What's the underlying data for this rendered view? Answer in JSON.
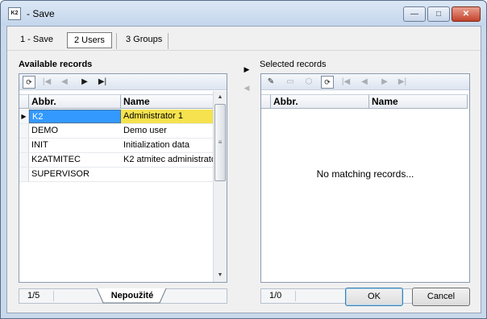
{
  "window": {
    "icon_text": "K2",
    "title": " - Save",
    "controls": {
      "minimize": "—",
      "maximize": "□",
      "close": "✕"
    }
  },
  "tabs": [
    {
      "label": "1  - Save",
      "active": false
    },
    {
      "label": "2 Users",
      "active": true
    },
    {
      "label": "3 Groups",
      "active": false
    }
  ],
  "available": {
    "title": "Available records",
    "toolbar_icons": [
      "refresh-icon",
      "first-record-icon",
      "previous-record-icon",
      "next-record-icon",
      "last-record-icon"
    ],
    "columns": {
      "abbr": "Abbr.",
      "name": "Name"
    },
    "rows": [
      {
        "abbr": "K2",
        "name": "Administrator 1",
        "selected": true,
        "indicator": "▶"
      },
      {
        "abbr": "DEMO",
        "name": "Demo user",
        "selected": false,
        "indicator": ""
      },
      {
        "abbr": "INIT",
        "name": "Initialization data",
        "selected": false,
        "indicator": ""
      },
      {
        "abbr": "K2ATMITEC",
        "name": "K2 atmitec administrato",
        "selected": false,
        "indicator": ""
      },
      {
        "abbr": "SUPERVISOR",
        "name": "",
        "selected": false,
        "indicator": ""
      }
    ],
    "status": {
      "count": "1/5",
      "filter_tab": "Nepoužité"
    }
  },
  "selected": {
    "title": "Selected records",
    "toolbar_icons": [
      "select-icon",
      "open-folder-icon",
      "cylinder-icon",
      "refresh-icon",
      "first-record-icon",
      "previous-record-icon",
      "next-record-icon",
      "last-record-icon"
    ],
    "columns": {
      "abbr": "Abbr.",
      "name": "Name"
    },
    "empty_message": "No matching records...",
    "status": {
      "count": "1/0"
    }
  },
  "move": {
    "add": "▶",
    "remove": "◀"
  },
  "buttons": {
    "ok": "OK",
    "cancel": "Cancel"
  },
  "colors": {
    "selection_blue": "#3399ff",
    "selection_yellow": "#f5e24e"
  }
}
